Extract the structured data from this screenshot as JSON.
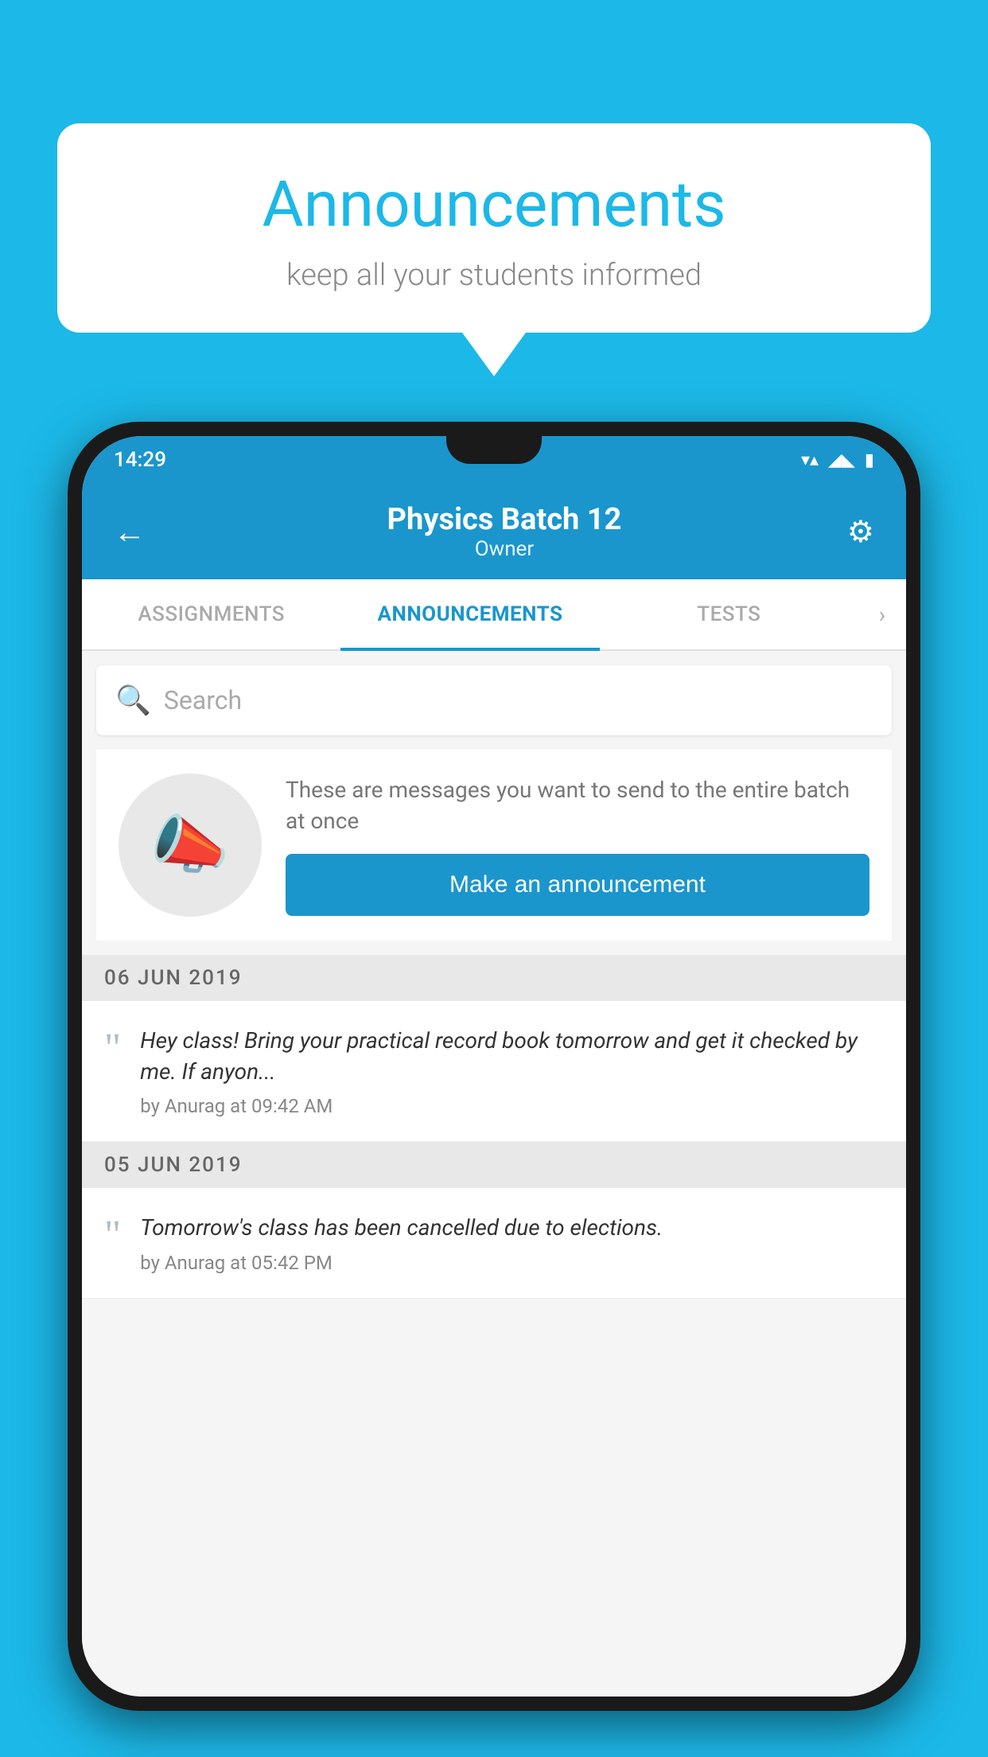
{
  "background_color": "#1cb8e8",
  "speech_bubble": {
    "title": "Announcements",
    "subtitle": "keep all your students informed"
  },
  "status_bar": {
    "time": "14:29",
    "wifi": "▼",
    "signal": "▲",
    "battery": "▮"
  },
  "app_bar": {
    "back_label": "←",
    "title": "Physics Batch 12",
    "subtitle": "Owner",
    "settings_label": "⚙"
  },
  "tabs": [
    {
      "label": "ASSIGNMENTS",
      "active": false
    },
    {
      "label": "ANNOUNCEMENTS",
      "active": true
    },
    {
      "label": "TESTS",
      "active": false
    }
  ],
  "search": {
    "placeholder": "Search"
  },
  "announcement_prompt": {
    "description": "These are messages you want to send to the entire batch at once",
    "button_label": "Make an announcement"
  },
  "announcements": [
    {
      "date": "06  JUN  2019",
      "message": "Hey class! Bring your practical record book tomorrow and get it checked by me. If anyon...",
      "meta": "by Anurag at 09:42 AM"
    },
    {
      "date": "05  JUN  2019",
      "message": "Tomorrow's class has been cancelled due to elections.",
      "meta": "by Anurag at 05:42 PM"
    }
  ]
}
